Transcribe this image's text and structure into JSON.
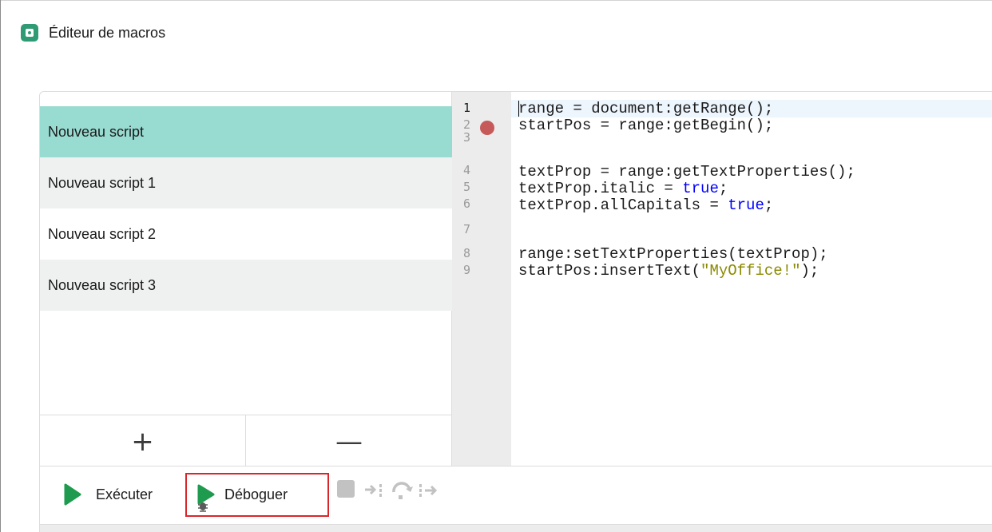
{
  "window": {
    "title": "Éditeur de macros",
    "icon": "macro-editor-app-icon",
    "accent_color": "#2e9b74"
  },
  "scripts": [
    {
      "label": "Nouveau script",
      "selected": true
    },
    {
      "label": "Nouveau script 1",
      "selected": false
    },
    {
      "label": "Nouveau script 2",
      "selected": false
    },
    {
      "label": "Nouveau script 3",
      "selected": false
    }
  ],
  "list_buttons": {
    "add_label": "+",
    "remove_label": "—"
  },
  "editor": {
    "line_numbers": [
      "1",
      "2",
      "3",
      "4",
      "5",
      "6",
      "7",
      "8",
      "9"
    ],
    "breakpoint_line": "2",
    "lines": [
      "range = document:getRange();",
      "startPos = range:getBegin();",
      "",
      "textProp = range:getTextProperties();",
      "textProp.italic = true;",
      "textProp.allCapitals = true;",
      "",
      "range:setTextProperties(textProp);",
      "startPos:insertText(\"MyOffice!\");"
    ],
    "keyword_color": "#0000ff",
    "string_color": "#8a8a00",
    "breakpoint_color": "#c65a5a"
  },
  "toolbar": {
    "run_label": "Exécuter",
    "debug_label": "Déboguer",
    "icons": [
      "play-icon",
      "debug-play-icon",
      "stop-icon",
      "step-into-icon",
      "step-over-icon",
      "step-out-icon"
    ],
    "run_color": "#1e9b4e",
    "highlight_color": "#d9262b"
  },
  "colors": {
    "selected_item": "#98dbd1",
    "alt_item": "#eff0f0",
    "gutter": "#ececec"
  }
}
